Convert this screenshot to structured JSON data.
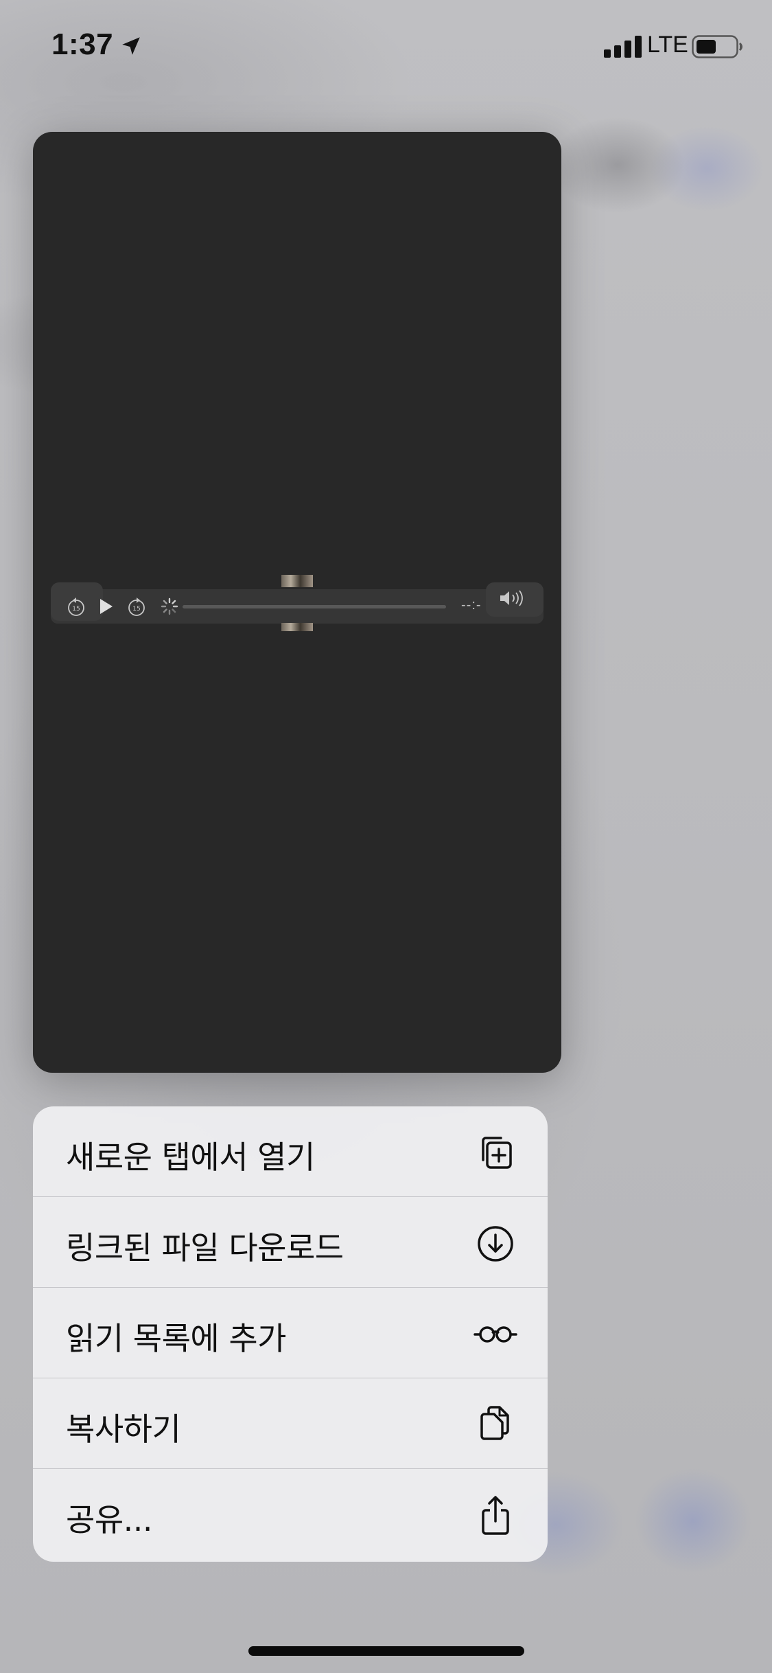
{
  "status_bar": {
    "time": "1:37",
    "network": "LTE",
    "icons": [
      "location-arrow-icon",
      "cellular-signal-icon",
      "battery-icon"
    ]
  },
  "preview": {
    "background_color": "#282828",
    "player": {
      "time_label": "--:-",
      "controls": [
        "skip-back-15-icon",
        "play-icon",
        "skip-forward-15-icon",
        "loading-spinner-icon",
        "volume-icon"
      ]
    }
  },
  "menu": {
    "items": [
      {
        "label": "새로운 탭에서 열기",
        "icon": "new-tab-icon"
      },
      {
        "label": "링크된 파일 다운로드",
        "icon": "download-icon"
      },
      {
        "label": "읽기 목록에 추가",
        "icon": "reading-list-glasses-icon"
      },
      {
        "label": "복사하기",
        "icon": "copy-icon"
      },
      {
        "label": "공유...",
        "icon": "share-icon"
      }
    ]
  },
  "colors": {
    "menu_background": "#f0f0f2",
    "backdrop": "#b9b9bd",
    "text": "#111111"
  }
}
